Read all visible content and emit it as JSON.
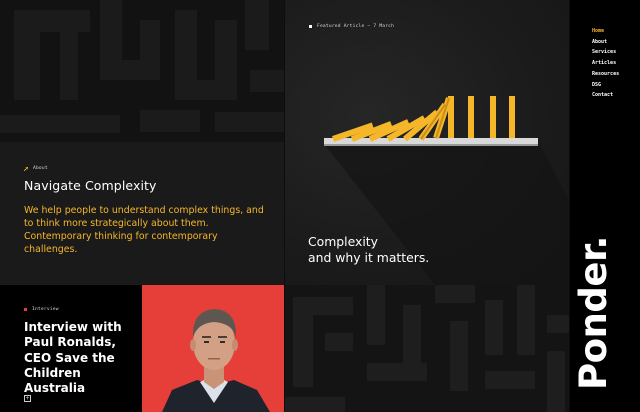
{
  "about": {
    "eyebrow": "About",
    "title": "Navigate Complexity",
    "body": "We help people to understand complex things, and to think more strategically about them. Contemporary thinking for contemporary challenges."
  },
  "featured": {
    "eyebrow": "Featured Article — 7 March",
    "title_line1": "Complexity",
    "title_line2": "and why it matters."
  },
  "interview": {
    "eyebrow": "Interview",
    "title": "Interview with Paul Ronalds, CEO Save the Children Australia",
    "more_label": "+"
  },
  "nav": {
    "items": [
      {
        "label": "Home"
      },
      {
        "label": "About"
      },
      {
        "label": "Services"
      },
      {
        "label": "Articles"
      },
      {
        "label": "Resources"
      },
      {
        "label": "DSG"
      },
      {
        "label": "Contact"
      }
    ]
  },
  "brand": {
    "logo": "Ponder."
  },
  "colors": {
    "accent": "#f5b62a",
    "red": "#e63f3a",
    "dark": "#141414"
  },
  "icons": {
    "about_dot": "arrow-icon",
    "featured_dot": "dot-icon",
    "interview_dot": "dot-icon"
  }
}
